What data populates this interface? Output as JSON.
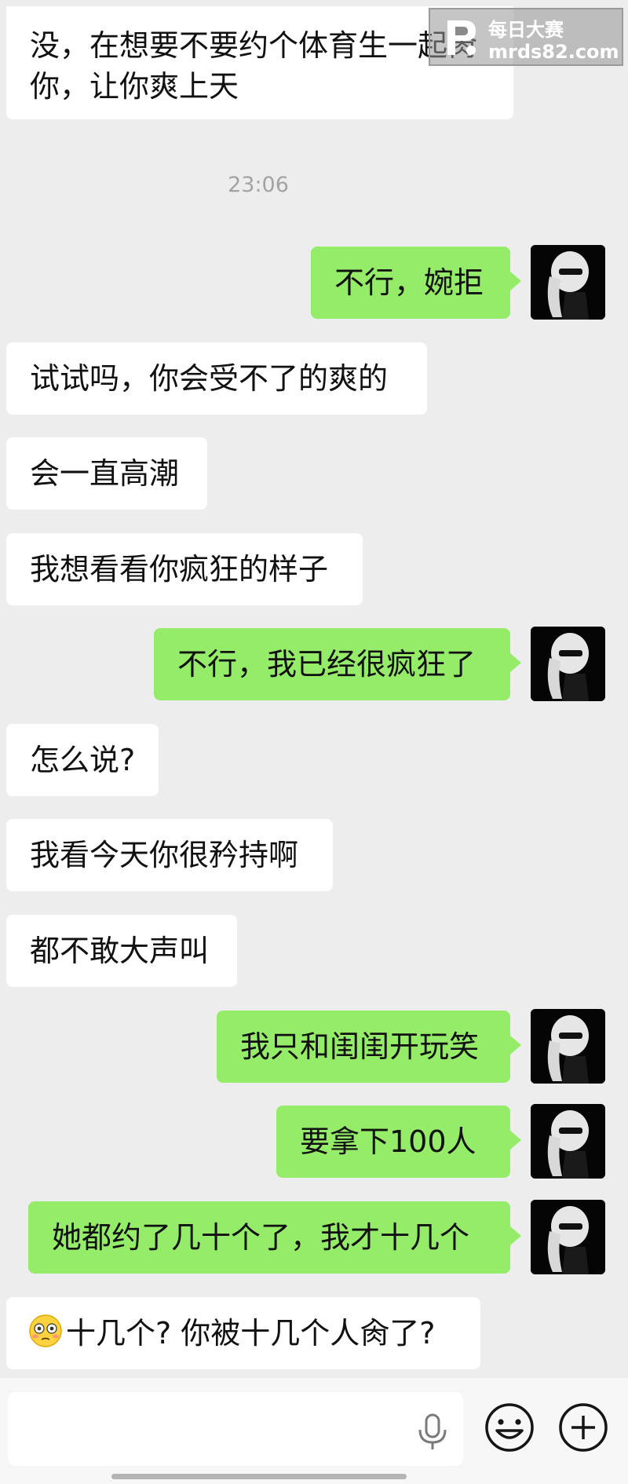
{
  "timestamp": "23:06",
  "messages": [
    {
      "side": "left",
      "text": "没，在想要不要约个体育生一起肏你，让你爽上天"
    },
    {
      "side": "right",
      "text": "不行，婉拒"
    },
    {
      "side": "left",
      "text": "试试吗，你会受不了的爽的"
    },
    {
      "side": "left",
      "text": "会一直高潮"
    },
    {
      "side": "left",
      "text": "我想看看你疯狂的样子"
    },
    {
      "side": "right",
      "text": "不行，我已经很疯狂了"
    },
    {
      "side": "left",
      "text": "怎么说?"
    },
    {
      "side": "left",
      "text": "我看今天你很矜持啊"
    },
    {
      "side": "left",
      "text": "都不敢大声叫"
    },
    {
      "side": "right",
      "text": "我只和闺闺开玩笑"
    },
    {
      "side": "right",
      "text": "要拿下100人"
    },
    {
      "side": "right",
      "text": "她都约了几十个了，我才十几个"
    },
    {
      "side": "left",
      "emoji": "flushed-face-emoji",
      "text": "十几个? 你被十几个人肏了?"
    }
  ],
  "chat_lines": {
    "first_line1": "没，在想要不要约个体育生一起肏",
    "first_line2": "你，让你爽上天"
  },
  "watermark": {
    "title": "每日大赛",
    "url": "mrds82.com"
  },
  "input_bar": {
    "placeholder": "",
    "icons": [
      "microphone-icon",
      "emoji-icon",
      "plus-icon"
    ]
  },
  "colors": {
    "background": "#ededed",
    "sent_bubble": "#95ec69",
    "received_bubble": "#ffffff"
  }
}
